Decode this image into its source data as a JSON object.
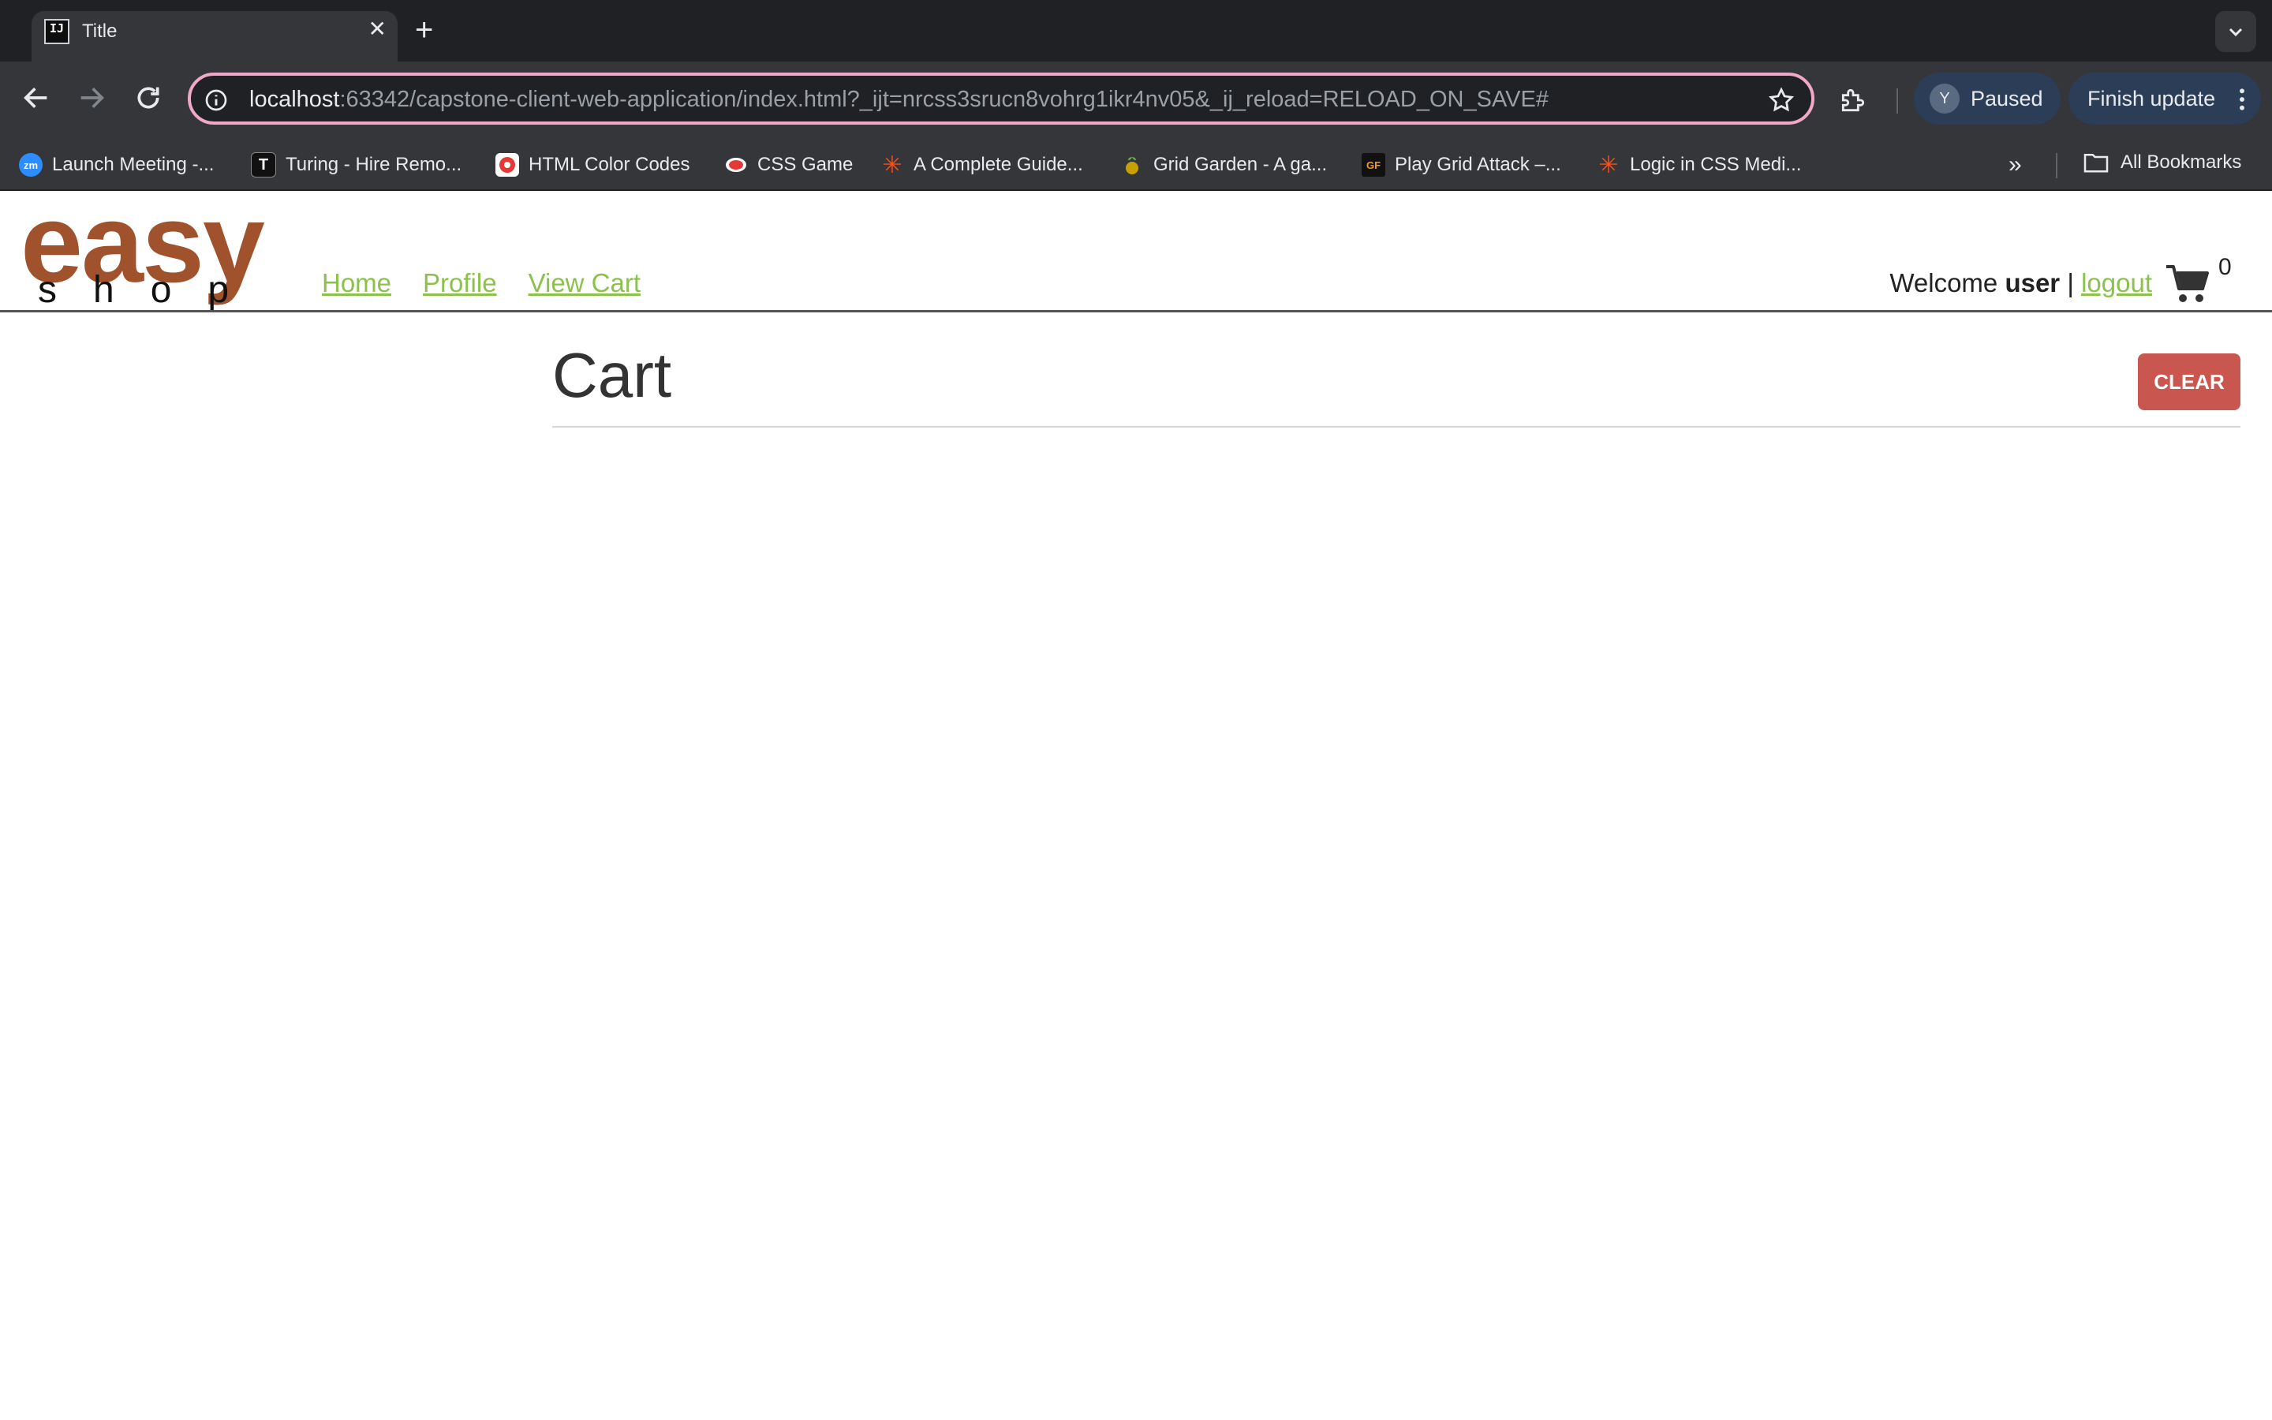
{
  "browser": {
    "tab": {
      "favicon_text": "IJ",
      "title": "Title"
    },
    "address_bar": {
      "host": "localhost",
      "path": ":63342/capstone-client-web-application/index.html?_ijt=nrcss3srucn8vohrg1ikr4nv05&_ij_reload=RELOAD_ON_SAVE#"
    },
    "profile": {
      "initial": "Y",
      "status": "Paused"
    },
    "update_button": "Finish update",
    "bookmarks": [
      {
        "label": "Launch Meeting -...",
        "icon": "zoom-icon",
        "icon_text": "zm",
        "color": "#2d8cff"
      },
      {
        "label": "Turing - Hire Remo...",
        "icon": "turing-icon",
        "icon_text": "T",
        "color": "#111111"
      },
      {
        "label": "HTML Color Codes",
        "icon": "color-wheel-icon",
        "icon_text": "",
        "color": "#e53935"
      },
      {
        "label": "CSS Game",
        "icon": "css-game-icon",
        "icon_text": "",
        "color": "#e53935"
      },
      {
        "label": "A Complete Guide...",
        "icon": "asterisk-icon",
        "icon_text": "✳",
        "color": "#f4511e"
      },
      {
        "label": "Grid Garden - A ga...",
        "icon": "grid-garden-icon",
        "icon_text": "",
        "color": "#c8a000"
      },
      {
        "label": "Play Grid Attack –...",
        "icon": "grid-attack-icon",
        "icon_text": "GF",
        "color": "#111111"
      },
      {
        "label": "Logic in CSS Medi...",
        "icon": "asterisk-icon",
        "icon_text": "✳",
        "color": "#f4511e"
      }
    ],
    "all_bookmarks": "All Bookmarks"
  },
  "site": {
    "logo": {
      "top": "easy",
      "bottom": "shop"
    },
    "nav": [
      {
        "label": "Home"
      },
      {
        "label": "Profile"
      },
      {
        "label": "View Cart"
      }
    ],
    "welcome": {
      "prefix": "Welcome ",
      "user": "user",
      "separator": " | ",
      "logout": "logout"
    },
    "cart_count": "0"
  },
  "main": {
    "title": "Cart",
    "clear_button": "CLEAR"
  },
  "colors": {
    "brand": "#a0522d",
    "link": "#8bc34a",
    "clear_button": "#c9564f"
  }
}
